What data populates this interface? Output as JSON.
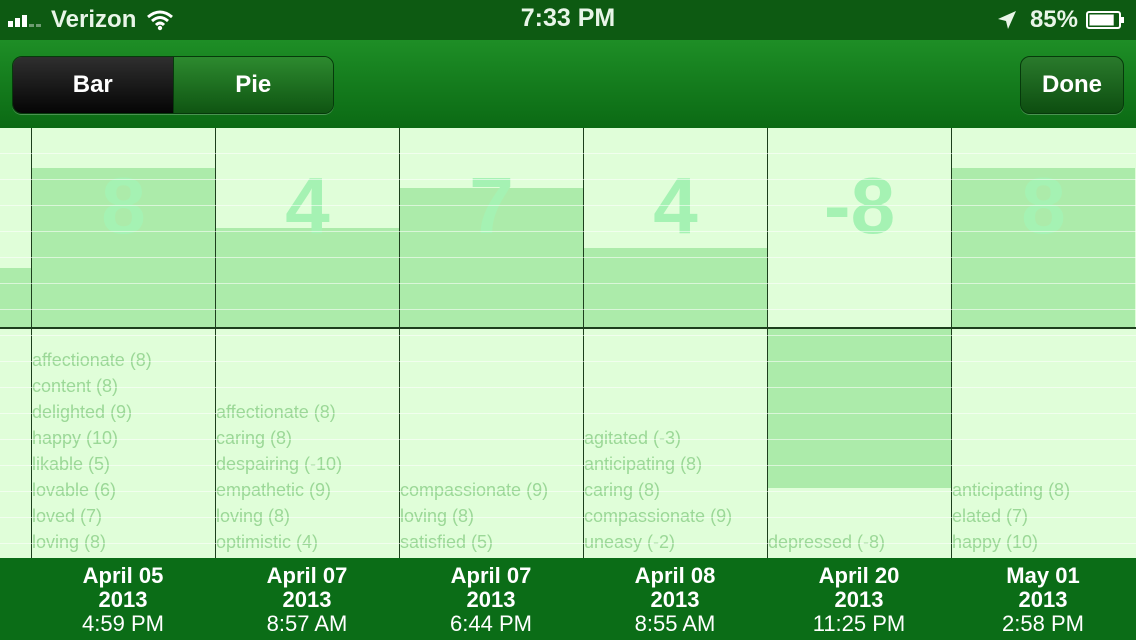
{
  "status_bar": {
    "carrier": "Verizon",
    "time": "7:33 PM",
    "battery": "85%",
    "battery_level": 0.85,
    "icons": [
      "signal-bars-icon",
      "wifi-icon",
      "location-arrow-icon",
      "battery-icon"
    ]
  },
  "nav": {
    "segment_bar_label": "Bar",
    "segment_pie_label": "Pie",
    "selected_segment": "Bar",
    "done_label": "Done"
  },
  "colors": {
    "brand_green": "#0b6d17",
    "status_green": "#0d5a12",
    "chart_bg": "#e0fed9",
    "bar_fill": "#acebaa",
    "value_text": "#a5f2b3",
    "mood_text": "#9bd897"
  },
  "chart_data": {
    "type": "bar",
    "ylim": [
      -10,
      10
    ],
    "partial_leading_bar_value": 3,
    "entries": [
      {
        "value": 8,
        "value_label": "8",
        "date": "April 05",
        "year": "2013",
        "time": "4:59 PM",
        "moods": [
          "affectionate (8)",
          "content (8)",
          "delighted (9)",
          "happy (10)",
          "likable (5)",
          "lovable (6)",
          "loved (7)",
          "loving (8)"
        ]
      },
      {
        "value": 5,
        "value_label": "4",
        "date": "April 07",
        "year": "2013",
        "time": "8:57 AM",
        "moods": [
          "affectionate (8)",
          "caring (8)",
          "despairing (-10)",
          "empathetic (9)",
          "loving (8)",
          "optimistic (4)"
        ]
      },
      {
        "value": 7,
        "value_label": "7",
        "date": "April 07",
        "year": "2013",
        "time": "6:44 PM",
        "moods": [
          "compassionate (9)",
          "loving (8)",
          "satisfied (5)"
        ]
      },
      {
        "value": 4,
        "value_label": "4",
        "date": "April 08",
        "year": "2013",
        "time": "8:55 AM",
        "moods": [
          "agitated (-3)",
          "anticipating (8)",
          "caring (8)",
          "compassionate (9)",
          "uneasy (-2)"
        ]
      },
      {
        "value": -8,
        "value_label": "-8",
        "date": "April 20",
        "year": "2013",
        "time": "11:25 PM",
        "moods": [
          "depressed (-8)"
        ]
      },
      {
        "value": 8,
        "value_label": "8",
        "date": "May 01",
        "year": "2013",
        "time": "2:58 PM",
        "moods": [
          "anticipating (8)",
          "elated (7)",
          "happy (10)"
        ]
      }
    ]
  }
}
